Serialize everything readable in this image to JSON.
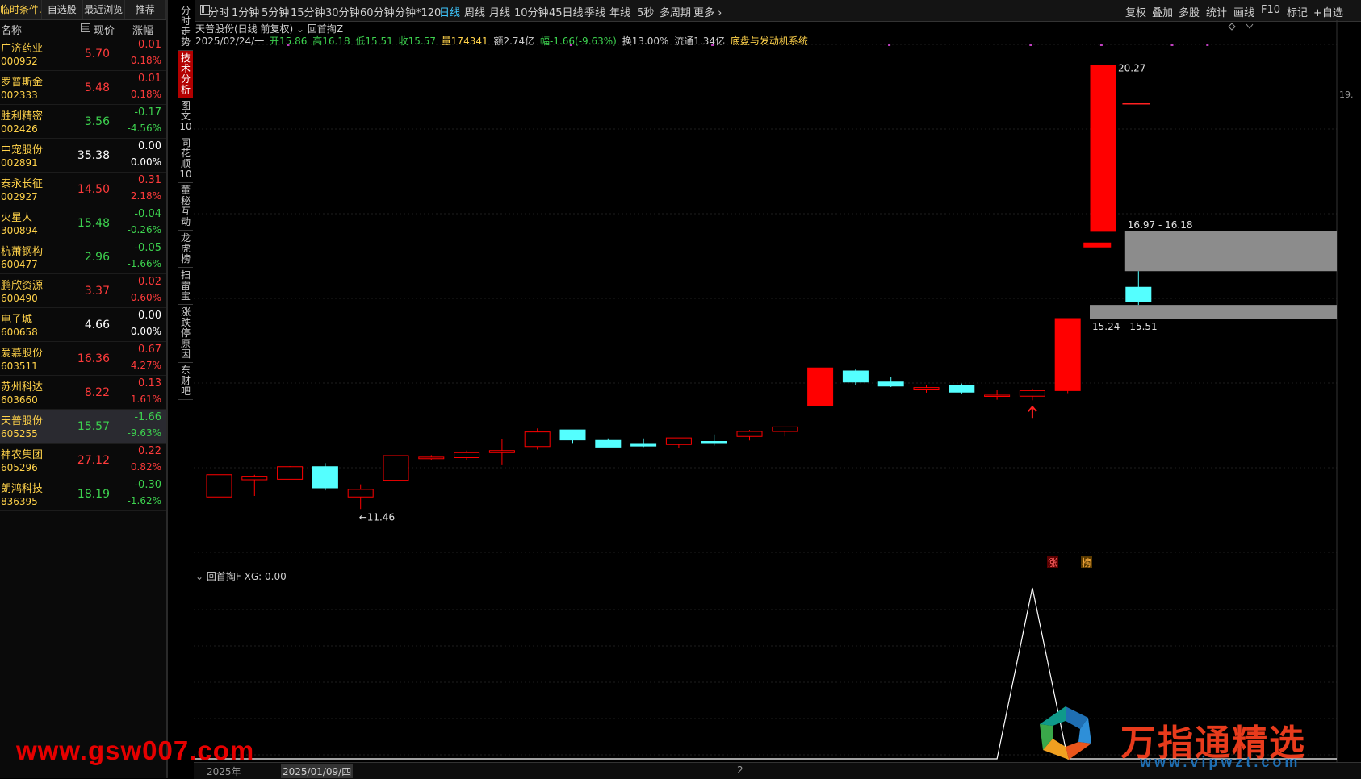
{
  "left_tabs": [
    {
      "label": "临时条件..",
      "active": true
    },
    {
      "label": "自选股",
      "active": false
    },
    {
      "label": "最近浏览",
      "active": false
    },
    {
      "label": "推荐",
      "active": false
    }
  ],
  "list_header": {
    "name": "名称",
    "price": "现价",
    "change": "涨幅"
  },
  "stocks": [
    {
      "name": "广济药业",
      "code": "000952",
      "price": "5.70",
      "chg": "0.01",
      "pct": "0.18%",
      "dir": "up"
    },
    {
      "name": "罗普斯金",
      "code": "002333",
      "price": "5.48",
      "chg": "0.01",
      "pct": "0.18%",
      "dir": "up"
    },
    {
      "name": "胜利精密",
      "code": "002426",
      "price": "3.56",
      "chg": "-0.17",
      "pct": "-4.56%",
      "dir": "dn"
    },
    {
      "name": "中宠股份",
      "code": "002891",
      "price": "35.38",
      "chg": "0.00",
      "pct": "0.00%",
      "dir": "eq"
    },
    {
      "name": "泰永长征",
      "code": "002927",
      "price": "14.50",
      "chg": "0.31",
      "pct": "2.18%",
      "dir": "up"
    },
    {
      "name": "火星人",
      "code": "300894",
      "price": "15.48",
      "chg": "-0.04",
      "pct": "-0.26%",
      "dir": "dn"
    },
    {
      "name": "杭萧钢构",
      "code": "600477",
      "price": "2.96",
      "chg": "-0.05",
      "pct": "-1.66%",
      "dir": "dn"
    },
    {
      "name": "鹏欣资源",
      "code": "600490",
      "price": "3.37",
      "chg": "0.02",
      "pct": "0.60%",
      "dir": "up"
    },
    {
      "name": "电子城",
      "code": "600658",
      "price": "4.66",
      "chg": "0.00",
      "pct": "0.00%",
      "dir": "eq"
    },
    {
      "name": "爱慕股份",
      "code": "603511",
      "price": "16.36",
      "chg": "0.67",
      "pct": "4.27%",
      "dir": "up"
    },
    {
      "name": "苏州科达",
      "code": "603660",
      "price": "8.22",
      "chg": "0.13",
      "pct": "1.61%",
      "dir": "up"
    },
    {
      "name": "天普股份",
      "code": "605255",
      "price": "15.57",
      "chg": "-1.66",
      "pct": "-9.63%",
      "dir": "dn",
      "selected": true
    },
    {
      "name": "神农集团",
      "code": "605296",
      "price": "27.12",
      "chg": "0.22",
      "pct": "0.82%",
      "dir": "up"
    },
    {
      "name": "朗鸿科技",
      "code": "836395",
      "price": "18.19",
      "chg": "-0.30",
      "pct": "-1.62%",
      "dir": "dn"
    }
  ],
  "side_tabs": [
    {
      "label": "分时走势",
      "active": false
    },
    {
      "label": "技术分析",
      "active": true
    },
    {
      "label": "图文10",
      "active": false
    },
    {
      "label": "同花顺10",
      "active": false
    },
    {
      "label": "董秘互动",
      "active": false
    },
    {
      "label": "龙虎榜",
      "active": false
    },
    {
      "label": "扫雷宝",
      "active": false
    },
    {
      "label": "涨跌停原因",
      "active": false
    },
    {
      "label": "东财吧",
      "active": false
    }
  ],
  "periods": [
    {
      "label": "分时",
      "active": false
    },
    {
      "label": "1分钟",
      "active": false
    },
    {
      "label": "5分钟",
      "active": false
    },
    {
      "label": "15分钟",
      "active": false
    },
    {
      "label": "30分钟",
      "active": false
    },
    {
      "label": "60分钟",
      "active": false
    },
    {
      "label": "分钟*120",
      "active": false
    },
    {
      "label": "日线",
      "active": true
    },
    {
      "label": "周线",
      "active": false
    },
    {
      "label": "月线",
      "active": false
    },
    {
      "label": "10分钟",
      "active": false
    },
    {
      "label": "45日线",
      "active": false
    },
    {
      "label": "季线",
      "active": false
    },
    {
      "label": "年线",
      "active": false
    },
    {
      "label": "5秒",
      "active": false
    },
    {
      "label": "多周期",
      "active": false
    },
    {
      "label": "更多 ›",
      "active": false
    }
  ],
  "right_tools": [
    "复权",
    "叠加",
    "多股",
    "统计",
    "画线",
    "F10",
    "标记",
    "+自选"
  ],
  "chart_header": {
    "title": "天普股份(日线 前复权)",
    "indicator": "回首掏Z",
    "date": "2025/02/24/一",
    "open": "开15.86",
    "high": "高16.18",
    "low": "低15.51",
    "close": "收15.57",
    "volume": "量174341",
    "amount": "额2.74亿",
    "change": "幅-1.66(-9.63%)",
    "turnover": "换13.00%",
    "float": "流通1.34亿",
    "system": "底盘与发动机系统"
  },
  "colors": {
    "up": "#ff0000",
    "down": "#54ffff",
    "accent": "#3fc8ff",
    "zone": "#8c8c8c",
    "name": "#ffd24a"
  },
  "chart_data": {
    "type": "candlestick",
    "ylim": [
      11.0,
      21.0
    ],
    "candles": [
      {
        "o": 11.7,
        "h": 12.14,
        "l": 11.7,
        "c": 12.14
      },
      {
        "o": 12.04,
        "h": 12.14,
        "l": 11.72,
        "c": 12.11
      },
      {
        "o": 12.05,
        "h": 12.31,
        "l": 12.05,
        "c": 12.3
      },
      {
        "o": 12.3,
        "h": 12.37,
        "l": 11.83,
        "c": 11.88
      },
      {
        "o": 11.7,
        "h": 11.95,
        "l": 11.46,
        "c": 11.85
      },
      {
        "o": 12.03,
        "h": 12.52,
        "l": 12.0,
        "c": 12.52
      },
      {
        "o": 12.46,
        "h": 12.53,
        "l": 12.44,
        "c": 12.49
      },
      {
        "o": 12.48,
        "h": 12.62,
        "l": 12.44,
        "c": 12.58
      },
      {
        "o": 12.58,
        "h": 12.84,
        "l": 12.33,
        "c": 12.62
      },
      {
        "o": 12.7,
        "h": 13.06,
        "l": 12.64,
        "c": 12.99
      },
      {
        "o": 13.03,
        "h": 13.03,
        "l": 12.77,
        "c": 12.83
      },
      {
        "o": 12.82,
        "h": 12.86,
        "l": 12.69,
        "c": 12.69
      },
      {
        "o": 12.76,
        "h": 12.86,
        "l": 12.69,
        "c": 12.71
      },
      {
        "o": 12.74,
        "h": 12.87,
        "l": 12.67,
        "c": 12.87
      },
      {
        "o": 12.8,
        "h": 12.94,
        "l": 12.72,
        "c": 12.79
      },
      {
        "o": 12.9,
        "h": 13.03,
        "l": 12.82,
        "c": 13.0
      },
      {
        "o": 13.0,
        "h": 13.09,
        "l": 12.9,
        "c": 13.09
      },
      {
        "o": 13.52,
        "h": 14.26,
        "l": 13.5,
        "c": 14.26
      },
      {
        "o": 14.2,
        "h": 14.23,
        "l": 13.92,
        "c": 13.98
      },
      {
        "o": 13.98,
        "h": 14.08,
        "l": 13.88,
        "c": 13.9
      },
      {
        "o": 13.84,
        "h": 13.92,
        "l": 13.77,
        "c": 13.87
      },
      {
        "o": 13.91,
        "h": 13.95,
        "l": 13.74,
        "c": 13.78
      },
      {
        "o": 13.72,
        "h": 13.83,
        "l": 13.63,
        "c": 13.72
      },
      {
        "o": 13.7,
        "h": 13.85,
        "l": 13.62,
        "c": 13.81
      },
      {
        "o": 13.81,
        "h": 15.24,
        "l": 13.76,
        "c": 15.24
      },
      {
        "o": 16.97,
        "h": 20.27,
        "l": 16.84,
        "c": 20.27
      },
      {
        "o": 15.86,
        "h": 16.18,
        "l": 15.51,
        "c": 15.57
      }
    ],
    "marks": [
      {
        "type": "dash",
        "index": 25.9,
        "value": 19.5,
        "color": "#ff2020"
      },
      {
        "type": "bar",
        "index": 24.8,
        "value": 16.7,
        "color": "#ff0000"
      }
    ],
    "zones": [
      {
        "from_index": 26,
        "top": 16.97,
        "bottom": 16.18,
        "label": "16.97 - 16.18"
      },
      {
        "from_index": 25,
        "top": 15.51,
        "bottom": 15.24,
        "label": "15.24 - 15.51"
      }
    ],
    "high_label": "20.27",
    "low_label": "←11.46",
    "right_axis_label": "19.",
    "badges": [
      "涨",
      "榜"
    ]
  },
  "sub_chart": {
    "title": "回首掏F",
    "xg_label": "XG: 0.00",
    "values": [
      0,
      0,
      0,
      0,
      0,
      0,
      0,
      0,
      0,
      0,
      0,
      0,
      0,
      0,
      0,
      0,
      0,
      0,
      0,
      0,
      0,
      0,
      0,
      1,
      0,
      0,
      0
    ]
  },
  "dates": {
    "year": "2025年",
    "cursor": "2025/01/09/四",
    "mid": "2"
  },
  "watermarks": {
    "left": "www.gsw007.com",
    "right": "万指通精选",
    "url": "www.vipwzt.com"
  }
}
